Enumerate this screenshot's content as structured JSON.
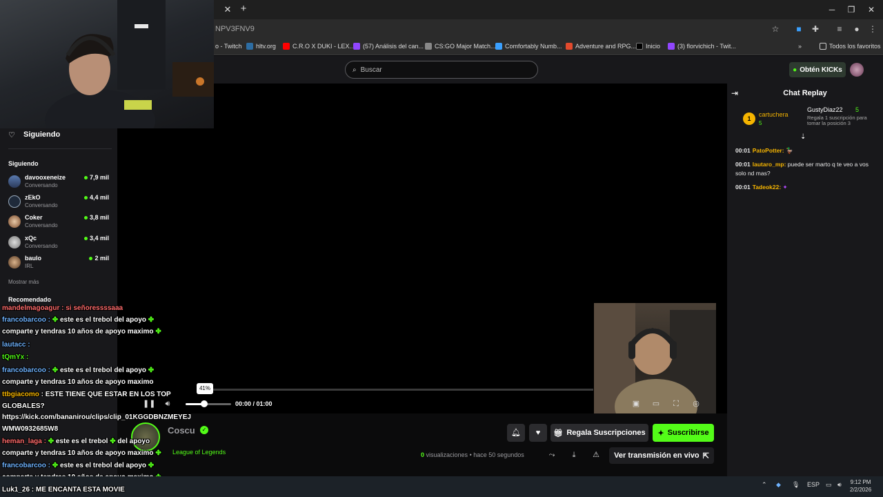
{
  "browser": {
    "url": "NPV3FNV9",
    "bookmarks": [
      {
        "label": "o - Twitch",
        "color": "#9146ff"
      },
      {
        "label": "hltv.org",
        "color": "#2d6da3"
      },
      {
        "label": "C.R.O X DUKI - LEX...",
        "color": "#ff0000"
      },
      {
        "label": "(57) Análisis del can...",
        "color": "#9146ff"
      },
      {
        "label": "CS:GO Major Match...",
        "color": "#888888"
      },
      {
        "label": "Comfortably Numb...",
        "color": "#3aa0ff"
      },
      {
        "label": "Adventure and RPG...",
        "color": "#e24a2d"
      },
      {
        "label": "Inicio",
        "color": "#000000"
      },
      {
        "label": "(3) florvichich - Twit...",
        "color": "#9146ff"
      }
    ],
    "all_bookmarks": "Todos los favoritos"
  },
  "header": {
    "search_placeholder": "Buscar",
    "obtain_label": "Obtén KICKs"
  },
  "sidebar": {
    "following_title": "Siguiendo",
    "following_section": "Siguiendo",
    "streamers": [
      {
        "name": "davooxeneize",
        "status": "Conversando",
        "viewers": "7,9 mil"
      },
      {
        "name": "zEkO",
        "status": "Conversando",
        "viewers": "4,4 mil"
      },
      {
        "name": "Coker",
        "status": "Conversando",
        "viewers": "3,8 mil"
      },
      {
        "name": "xQc",
        "status": "Conversando",
        "viewers": "3,4 mil"
      },
      {
        "name": "baulo",
        "status": "IRL",
        "viewers": "2 mil"
      }
    ],
    "show_more": "Mostrar más",
    "recommended": "Recomendado"
  },
  "player": {
    "volume_percent": "41%",
    "volume_level": 0.41,
    "time": "00:00 / 01:00"
  },
  "channel": {
    "name": "Coscu",
    "category": "League of Legends",
    "gift_label": "Regala Suscripciones",
    "subscribe_label": "Suscribirse",
    "views_count": "0",
    "views_label": "visualizaciones",
    "time_ago": "hace 50 segundos",
    "live_label": "Ver transmisión en vivo"
  },
  "chat": {
    "title": "Chat Replay",
    "pinned_rank": "1",
    "pinned_user": "cartuchera",
    "pinned_count": "5",
    "gift_user": "GustyDiaz22",
    "gift_count": "5",
    "gift_note": "Regala 1 suscripción para tomar la posición 3",
    "messages": [
      {
        "time": "00:01",
        "user": "PatoPotter:",
        "text": "",
        "color": "#f5b400"
      },
      {
        "time": "00:01",
        "user": "lautaro_mp:",
        "text": "puede ser marto q te veo a vos solo nd mas?",
        "color": "#f5b400"
      },
      {
        "time": "00:01",
        "user": "Tadeok22:",
        "text": "",
        "color": "#f5b400"
      }
    ]
  },
  "overlay_chat": [
    {
      "user": "francobarcoo :",
      "text": " este es el trebol  del apoyo ",
      "color": "#6fb3ff"
    },
    {
      "user": "",
      "text": "comparte y tendras 10 años de  apoyo maximo ",
      "color": "#fff"
    },
    {
      "user": "lautacc :",
      "text": "",
      "color": "#6fb3ff"
    },
    {
      "user": "tQmYx :",
      "text": "",
      "color": "#53fc18"
    },
    {
      "user": "francobarcoo :",
      "text": " este es el trebol  del apoyo ",
      "color": "#6fb3ff"
    },
    {
      "user": "",
      "text": "comparte y tendras 10 años de  apoyo maximo",
      "color": "#fff"
    },
    {
      "user": "",
      "text": ": ESTE TIENE QUE ESTAR EN LOS TOP",
      "color": "#fff"
    },
    {
      "user": "",
      "text": "GLOBALES?",
      "color": "#fff"
    },
    {
      "user": "",
      "text": "https://kick.com/bananirou/clips/clip_01KGGDBNZMEYEJ",
      "color": "#fff"
    },
    {
      "user": "",
      "text": "WMW0932685W8",
      "color": "#fff"
    },
    {
      "user": "heman_laga :",
      "text": "",
      "color": "#ff6b6b"
    },
    {
      "user": "",
      "text": "comparte y tendras 10 años de  apoyo maximo ",
      "color": "#fff"
    },
    {
      "user": "francobarcoo :",
      "text": " este es el trebol  del apoyo ",
      "color": "#6fb3ff"
    },
    {
      "user": "",
      "text": "comparte y tendras 10 años de  apoyo maximo ",
      "color": "#fff"
    },
    {
      "user": "Luk1_26 :",
      "text": " ME ENCANTA ESTA MOVIE",
      "color": "#fff"
    }
  ],
  "taskbar": {
    "lang": "ESP",
    "time": "9:12 PM",
    "date": "2/2/2026"
  }
}
